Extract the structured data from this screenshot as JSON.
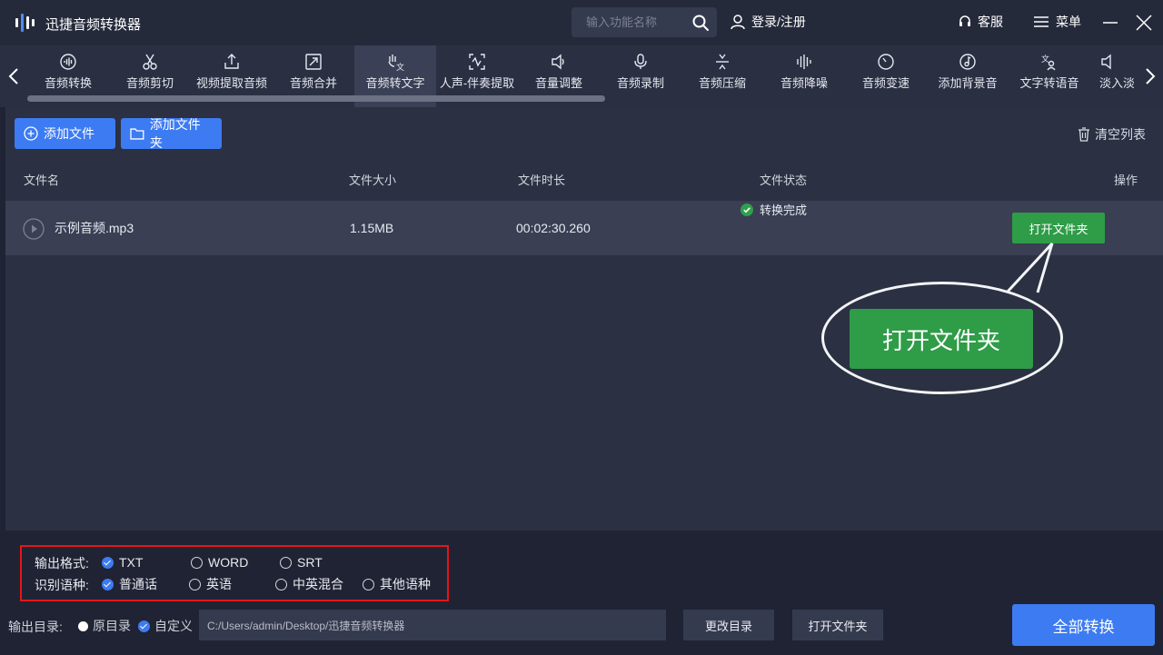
{
  "app": {
    "title": "迅捷音频转换器"
  },
  "header": {
    "search_placeholder": "输入功能名称",
    "login": "登录/注册",
    "service": "客服",
    "menu": "菜单"
  },
  "tabs": [
    {
      "label": "音频转换",
      "icon": "waveform-circle-icon"
    },
    {
      "label": "音频剪切",
      "icon": "scissors-icon"
    },
    {
      "label": "视频提取音频",
      "icon": "upload-icon"
    },
    {
      "label": "音频合并",
      "icon": "merge-icon"
    },
    {
      "label": "音频转文字",
      "icon": "hand-text-icon",
      "active": true
    },
    {
      "label": "人声-伴奏提取",
      "icon": "voice-extract-icon"
    },
    {
      "label": "音量调整",
      "icon": "speaker-icon"
    },
    {
      "label": "音频录制",
      "icon": "microphone-icon"
    },
    {
      "label": "音频压缩",
      "icon": "compress-icon"
    },
    {
      "label": "音频降噪",
      "icon": "denoise-icon"
    },
    {
      "label": "音频变速",
      "icon": "speed-dial-icon"
    },
    {
      "label": "添加背景音",
      "icon": "music-note-icon"
    },
    {
      "label": "文字转语音",
      "icon": "text-speech-icon"
    },
    {
      "label": "淡入淡出",
      "icon": "fade-icon"
    }
  ],
  "toolbar": {
    "add_file": "添加文件",
    "add_folder": "添加文件夹",
    "clear_list": "清空列表"
  },
  "table": {
    "columns": [
      "文件名",
      "文件大小",
      "文件时长",
      "文件状态",
      "操作"
    ],
    "rows": [
      {
        "name": "示例音频.mp3",
        "size": "1.15MB",
        "duration": "00:02:30.260",
        "status": "转换完成",
        "action": "打开文件夹"
      }
    ]
  },
  "callout": {
    "label": "打开文件夹"
  },
  "settings": {
    "format_label": "输出格式:",
    "formats": [
      {
        "label": "TXT",
        "selected": true
      },
      {
        "label": "WORD",
        "selected": false
      },
      {
        "label": "SRT",
        "selected": false
      }
    ],
    "lang_label": "识别语种:",
    "languages": [
      {
        "label": "普通话",
        "selected": true
      },
      {
        "label": "英语",
        "selected": false
      },
      {
        "label": "中英混合",
        "selected": false
      },
      {
        "label": "其他语种",
        "selected": false
      }
    ]
  },
  "output": {
    "label": "输出目录:",
    "original": "原目录",
    "custom": "自定义",
    "path": "C:/Users/admin/Desktop/迅捷音频转换器",
    "change_dir": "更改目录",
    "open_folder": "打开文件夹"
  },
  "convert_all": "全部转换",
  "colors": {
    "accent": "#3d7bf2",
    "success": "#2f9c48",
    "highlight_border": "#e6151a"
  }
}
